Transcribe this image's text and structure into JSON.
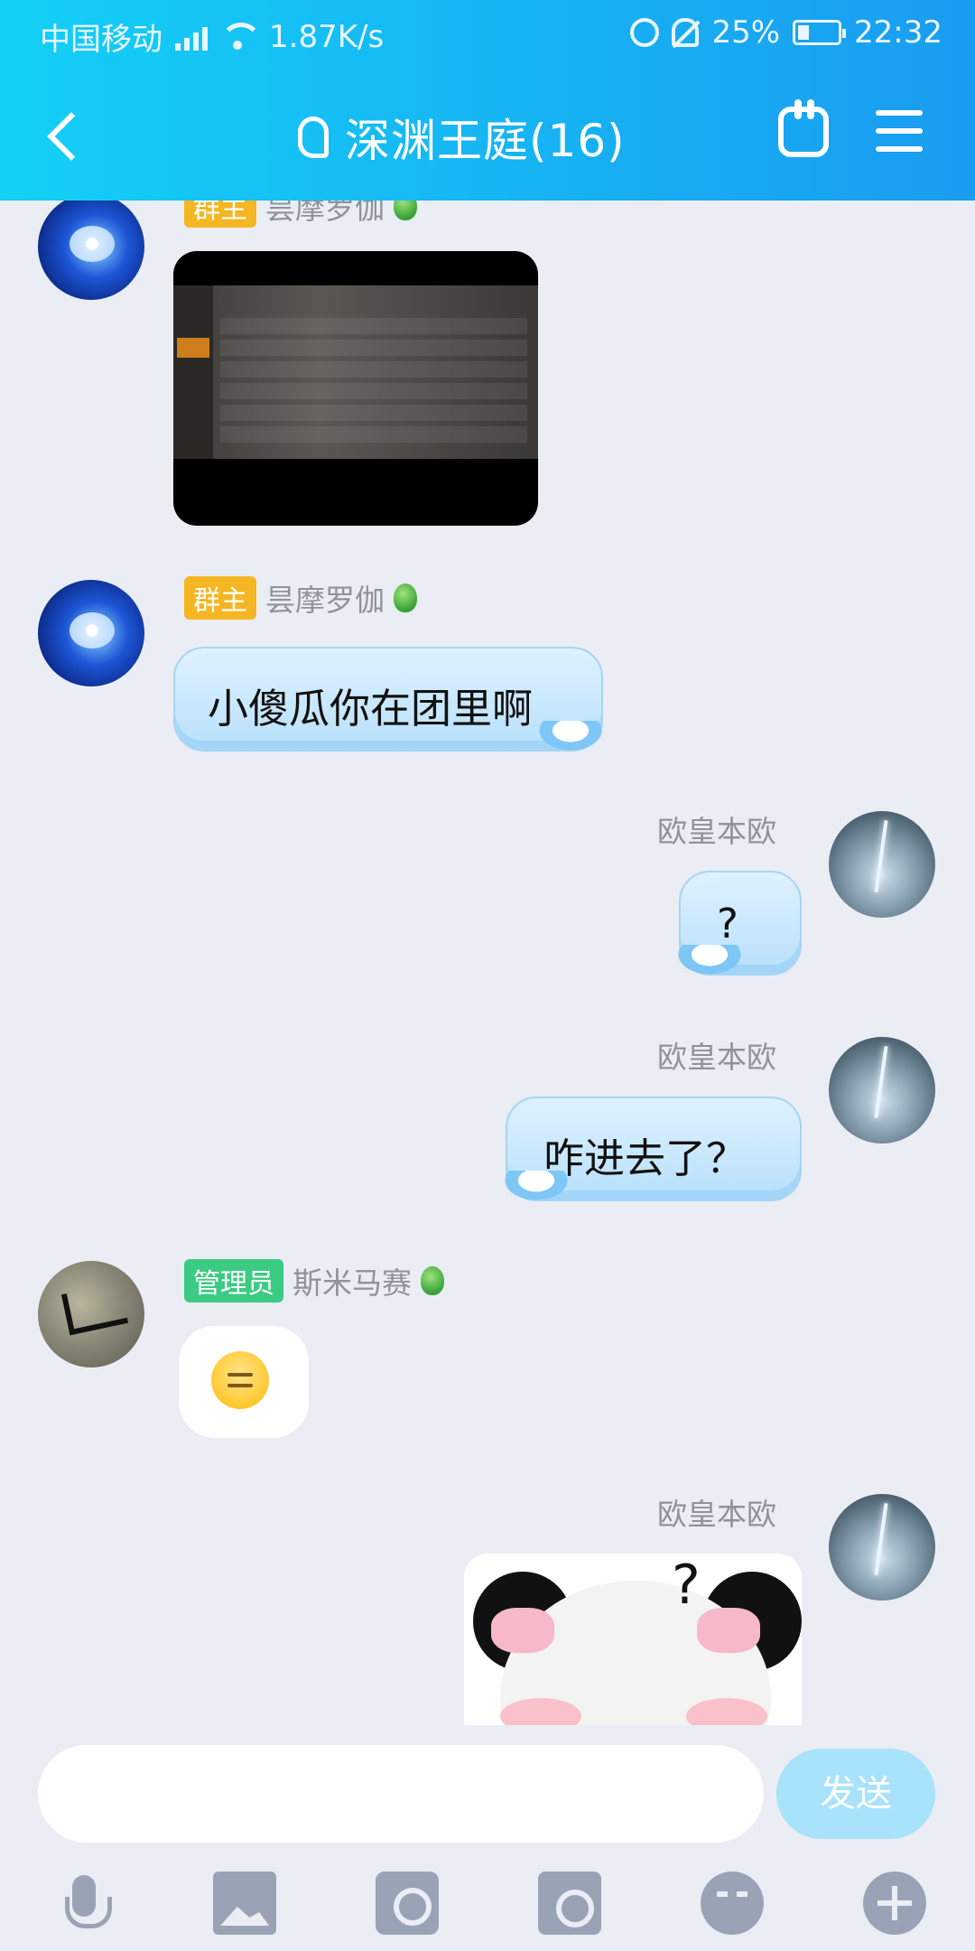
{
  "status_bar": {
    "carrier": "中国移动",
    "speed": "1.87K/s",
    "battery": "25%",
    "time": "22:32"
  },
  "header": {
    "title": "深渊王庭(16)"
  },
  "messages": [
    {
      "sender": "昙摩罗伽",
      "badge": "群主",
      "type": "image"
    },
    {
      "sender": "昙摩罗伽",
      "badge": "群主",
      "type": "text",
      "text": "小傻瓜你在团里啊"
    },
    {
      "sender": "欧皇本欧",
      "type": "text",
      "text": "?"
    },
    {
      "sender": "欧皇本欧",
      "type": "text",
      "text": "咋进去了？"
    },
    {
      "sender": "斯米马赛",
      "badge": "管理员",
      "type": "emoji"
    },
    {
      "sender": "欧皇本欧",
      "type": "sticker"
    }
  ],
  "input": {
    "placeholder": "",
    "send_label": "发送"
  },
  "colors": {
    "header_start": "#14d0f6",
    "header_end": "#1a9cf0",
    "chat_bg": "#eaedf4",
    "owner_badge": "#f5b623",
    "admin_badge": "#3ccb83",
    "send_button": "#a8e2fb"
  },
  "icons": [
    "back-icon",
    "ear-icon",
    "hand-icon",
    "menu-icon",
    "mic-icon",
    "image-icon",
    "camera-icon",
    "red-packet-icon",
    "emoji-icon",
    "plus-icon"
  ]
}
